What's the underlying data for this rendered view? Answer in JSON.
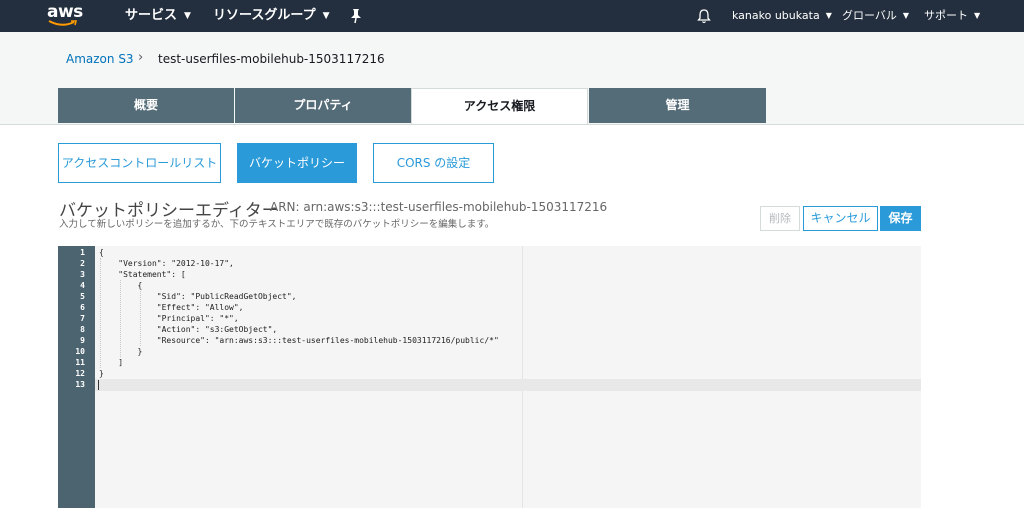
{
  "topbar": {
    "logo": "aws",
    "services": "サービス",
    "resource_groups": "リソースグループ",
    "pin_icon": "pin-icon",
    "bell_icon": "bell-icon",
    "user": "kanako ubukata",
    "region": "グローバル",
    "support": "サポート",
    "caret": "▼"
  },
  "breadcrumb": {
    "root": "Amazon S3",
    "separator": "›",
    "current": "test-userfiles-mobilehub-1503117216"
  },
  "tabs": [
    {
      "label": "概要"
    },
    {
      "label": "プロパティ"
    },
    {
      "label": "アクセス権限"
    },
    {
      "label": "管理"
    }
  ],
  "subtabs": [
    {
      "label": "アクセスコントロールリスト"
    },
    {
      "label": "バケットポリシー"
    },
    {
      "label": "CORS の設定"
    }
  ],
  "editor": {
    "title": "バケットポリシーエディター",
    "arn": "ARN: arn:aws:s3:::test-userfiles-mobilehub-1503117216",
    "description": "入力して新しいポリシーを追加するか、下のテキストエリアで既存のバケットポリシーを編集します。",
    "delete_label": "削除",
    "cancel_label": "キャンセル",
    "save_label": "保存",
    "line_numbers": [
      "1",
      "2",
      "3",
      "4",
      "5",
      "6",
      "7",
      "8",
      "9",
      "10",
      "11",
      "12",
      "13"
    ],
    "lines": [
      "{",
      "    \"Version\": \"2012-10-17\",",
      "    \"Statement\": [",
      "        {",
      "            \"Sid\": \"PublicReadGetObject\",",
      "            \"Effect\": \"Allow\",",
      "            \"Principal\": \"*\",",
      "            \"Action\": \"s3:GetObject\",",
      "            \"Resource\": \"arn:aws:s3:::test-userfiles-mobilehub-1503117216/public/*\"",
      "        }",
      "    ]",
      "}",
      ""
    ]
  },
  "colors": {
    "topbar": "#232f3e",
    "tab_inactive": "#546b78",
    "accent": "#2a9ad9",
    "gutter": "#4c6470"
  }
}
